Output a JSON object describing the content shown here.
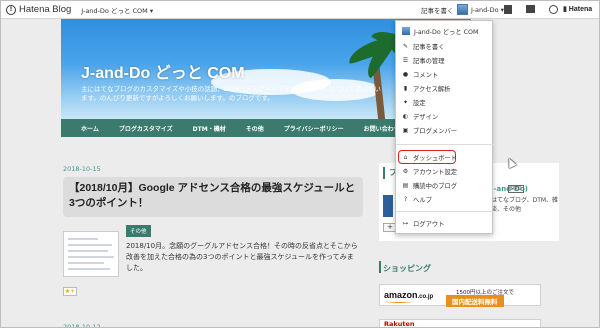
{
  "topbar": {
    "logo_text": "Hatena Blog",
    "blog_switch": "J-and-Do どっと COM ▾",
    "write_label": "記事を書く",
    "account_label": "J-and-Do ▾",
    "hatena_right": "Hatena"
  },
  "blog": {
    "title": "J-and-Do どっと COM",
    "description": "主にはてなブログのカスタマイズや小技の話題、DTM（デスクトップミュージック）について書いています。のんびり更新ですがよろしくお願いします。のブログです。"
  },
  "nav": {
    "items": [
      "ホーム",
      "ブログカスタマイズ",
      "DTM・機材",
      "その他",
      "プライバシーポリシー",
      "お問い合わせ"
    ]
  },
  "post": {
    "date": "2018-10-15",
    "title": "【2018/10月】Google アドセンス合格の最強スケジュールと3つのポイント！",
    "category": "その他",
    "excerpt": "2018/10月。念願のグーグルアドセンス合格！その時の反省点とそこから改善を加えた合格の為の3つのポイントと最強スケジュールを作ってみました。",
    "star": "★+",
    "next_date": "2018-10-12"
  },
  "sidebar": {
    "profile_title": "プ",
    "profile_name": "J-and-Do)",
    "pro_badge": "PRO",
    "profile_text": "はてなブログ、DTM、雑談、その他",
    "plus": "+",
    "shopping_title": "ショッピング",
    "amazon_logo": "amazon",
    "amazon_tld": ".co.jp",
    "amazon_top": "1500円以上のご注文で",
    "amazon_banner": "国内配送料無料",
    "rakuten": "Rakuten"
  },
  "dropdown": {
    "blog_name": "J-and-Do どっと COM",
    "items": [
      {
        "icon": "pencil-icon",
        "glyph": "✎",
        "label": "記事を書く"
      },
      {
        "icon": "list-icon",
        "glyph": "☰",
        "label": "記事の管理"
      },
      {
        "icon": "comment-icon",
        "glyph": "●",
        "label": "コメント"
      },
      {
        "icon": "chart-icon",
        "glyph": "▮",
        "label": "アクセス解析"
      },
      {
        "icon": "wrench-icon",
        "glyph": "✦",
        "label": "設定"
      },
      {
        "icon": "palette-icon",
        "glyph": "◐",
        "label": "デザイン"
      },
      {
        "icon": "members-icon",
        "glyph": "▣",
        "label": "ブログメンバー"
      }
    ],
    "dashboard": {
      "icon": "home-icon",
      "glyph": "⌂",
      "label": "ダッシュボード"
    },
    "account_items": [
      {
        "icon": "gear-icon",
        "glyph": "⚙",
        "label": "アカウント設定"
      },
      {
        "icon": "bookmark-icon",
        "glyph": "▤",
        "label": "購読中のブログ"
      },
      {
        "icon": "help-icon",
        "glyph": "?",
        "label": "ヘルプ"
      }
    ],
    "logout": {
      "icon": "logout-icon",
      "glyph": "↦",
      "label": "ログアウト"
    }
  }
}
